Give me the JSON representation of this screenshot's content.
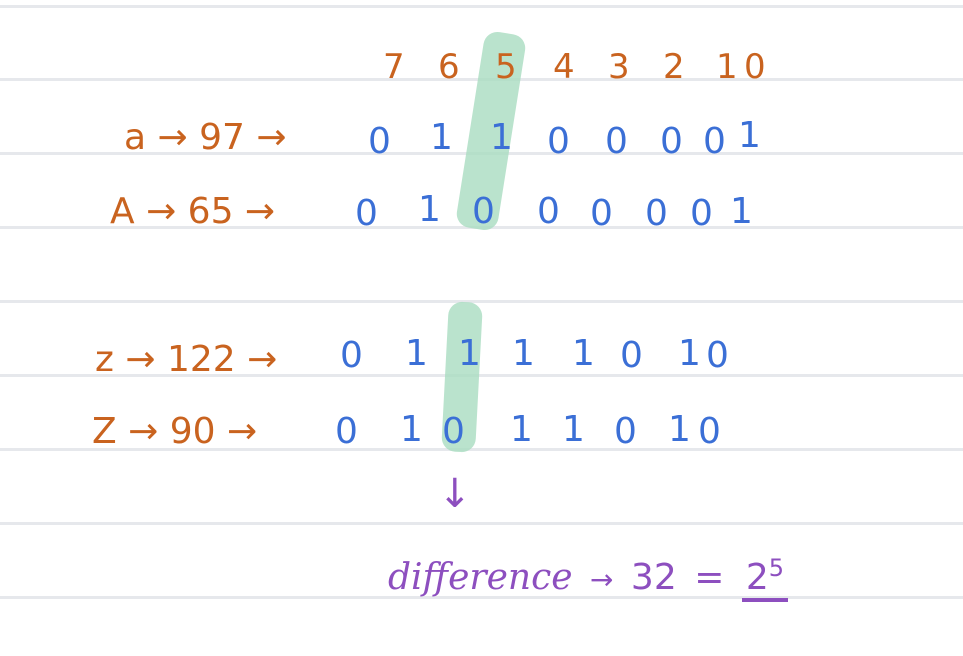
{
  "header": {
    "bit_positions": [
      "7",
      "6",
      "5",
      "4",
      "3",
      "2",
      "1",
      "0"
    ]
  },
  "rows": [
    {
      "label": "a → 97 →",
      "bits": [
        "0",
        "1",
        "1",
        "0",
        "0",
        "0",
        "0",
        "1"
      ]
    },
    {
      "label": "A → 65 →",
      "bits": [
        "0",
        "1",
        "0",
        "0",
        "0",
        "0",
        "0",
        "1"
      ]
    },
    {
      "label": "z → 122 →",
      "bits": [
        "0",
        "1",
        "1",
        "1",
        "1",
        "0",
        "1",
        "0"
      ]
    },
    {
      "label": "Z → 90 →",
      "bits": [
        "0",
        "1",
        "0",
        "1",
        "1",
        "0",
        "1",
        "0"
      ]
    }
  ],
  "arrow": "↓",
  "result": {
    "word": "difference",
    "arrow": "→",
    "value": "32",
    "equals": "=",
    "base": "2",
    "exponent": "5"
  },
  "colors": {
    "orange": "#c9631f",
    "blue": "#3b6fd6",
    "purple": "#8d4fbf",
    "highlight": "#a9dcc1",
    "rule": "#e6e8ec"
  }
}
